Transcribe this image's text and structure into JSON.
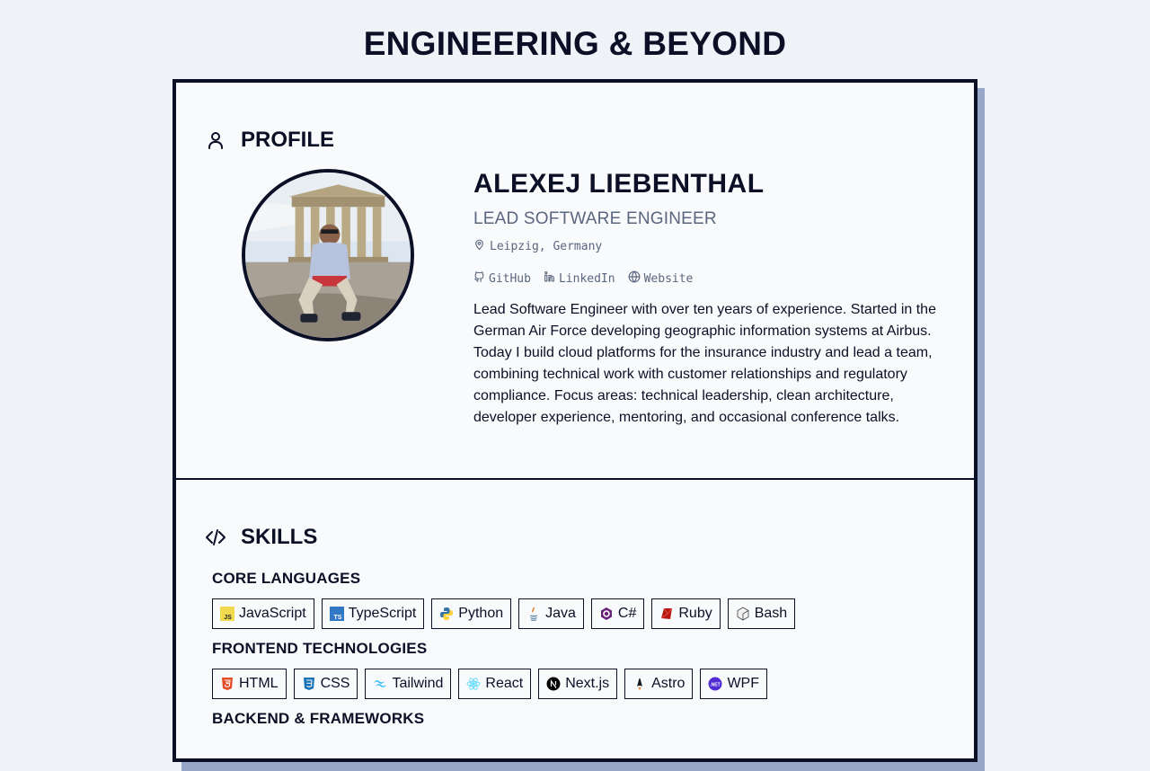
{
  "site": {
    "title": "ENGINEERING & BEYOND"
  },
  "profile": {
    "section_title": "PROFILE",
    "name": "ALEXEJ LIEBENTHAL",
    "role": "LEAD SOFTWARE ENGINEER",
    "location": "Leipzig, Germany",
    "links": [
      {
        "label": "GitHub",
        "icon": "github-icon"
      },
      {
        "label": "LinkedIn",
        "icon": "linkedin-icon"
      },
      {
        "label": "Website",
        "icon": "globe-icon"
      }
    ],
    "bio": "Lead Software Engineer with over ten years of experience. Started in the German Air Force developing geographic information systems at Airbus. Today I build cloud platforms for the insurance industry and lead a team, combining technical work with customer relationships and regulatory compliance. Focus areas: technical leadership, clean architecture, developer experience, mentoring, and occasional conference talks."
  },
  "skills": {
    "section_title": "SKILLS",
    "groups": [
      {
        "title": "CORE LANGUAGES",
        "items": [
          {
            "label": "JavaScript",
            "icon": "javascript-icon"
          },
          {
            "label": "TypeScript",
            "icon": "typescript-icon"
          },
          {
            "label": "Python",
            "icon": "python-icon"
          },
          {
            "label": "Java",
            "icon": "java-icon"
          },
          {
            "label": "C#",
            "icon": "csharp-icon"
          },
          {
            "label": "Ruby",
            "icon": "ruby-icon"
          },
          {
            "label": "Bash",
            "icon": "bash-icon"
          }
        ]
      },
      {
        "title": "FRONTEND TECHNOLOGIES",
        "items": [
          {
            "label": "HTML",
            "icon": "html-icon"
          },
          {
            "label": "CSS",
            "icon": "css-icon"
          },
          {
            "label": "Tailwind",
            "icon": "tailwind-icon"
          },
          {
            "label": "React",
            "icon": "react-icon"
          },
          {
            "label": "Next.js",
            "icon": "nextjs-icon"
          },
          {
            "label": "Astro",
            "icon": "astro-icon"
          },
          {
            "label": "WPF",
            "icon": "dotnet-icon"
          }
        ]
      },
      {
        "title": "BACKEND & FRAMEWORKS",
        "items": []
      }
    ]
  },
  "colors": {
    "ink": "#0b1026",
    "muted": "#5b667f",
    "card": "#f8fafc",
    "page": "#eff3f8",
    "shadow": "#98a6c8"
  }
}
